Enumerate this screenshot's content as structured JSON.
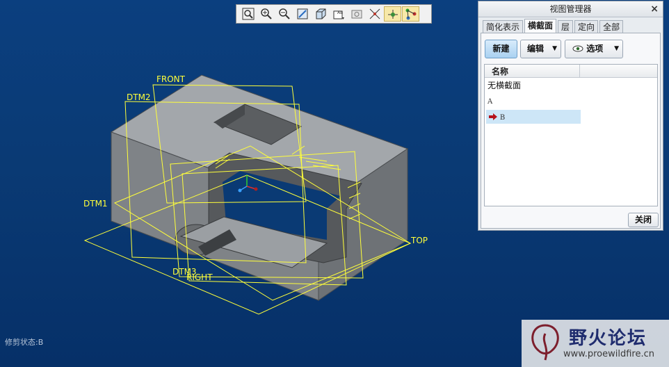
{
  "toolbar": {
    "buttons": [
      {
        "name": "refit-icon"
      },
      {
        "name": "zoom-in-icon"
      },
      {
        "name": "zoom-out-icon"
      },
      {
        "name": "repaint-icon"
      },
      {
        "name": "shading-icon"
      },
      {
        "name": "saved-views-icon"
      },
      {
        "name": "view-manager-icon"
      },
      {
        "name": "datum-display-icon"
      },
      {
        "name": "spin-center-icon"
      },
      {
        "name": "annotation-display-icon"
      }
    ]
  },
  "viewport": {
    "datum_labels": {
      "front": "FRONT",
      "dtm2": "DTM2",
      "dtm1": "DTM1",
      "dtm3": "DTM3",
      "right": "RIGHT",
      "top": "TOP"
    },
    "status": "修剪状态:B"
  },
  "panel": {
    "title": "视图管理器",
    "close_glyph": "×",
    "tabs": [
      "简化表示",
      "横截面",
      "层",
      "定向",
      "全部"
    ],
    "active_tab": "横截面",
    "new_button": "新建",
    "edit_button": "编辑",
    "options_button": "选项",
    "list_header": "名称",
    "rows": [
      "无横截面",
      "A",
      "B"
    ],
    "selected_row": "B",
    "close_button": "关闭"
  },
  "watermark": {
    "cn": "野火论坛",
    "url": "www.proewildfire.cn"
  },
  "colors": {
    "datum": "#ffff3a",
    "background": "#0b3f7f",
    "model_gray": "#8c9094",
    "selection": "#cde6f7"
  }
}
